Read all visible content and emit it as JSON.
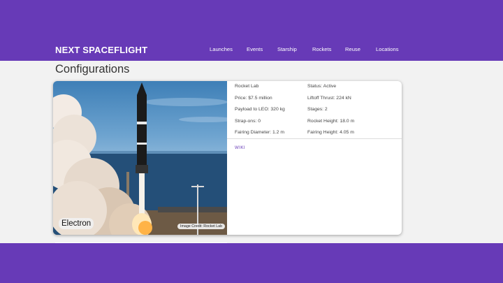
{
  "header": {
    "brand": "NEXT SPACEFLIGHT",
    "nav": [
      "Launches",
      "Events",
      "Starship",
      "Rockets",
      "Reuse",
      "Locations"
    ]
  },
  "page": {
    "title": "Configurations"
  },
  "card": {
    "rocket_name": "Electron",
    "image_credit": "Image Credit: Rocket Lab",
    "details": {
      "manufacturer": "Rocket Lab",
      "status": "Status: Active",
      "price": "Price: $7.5 million",
      "liftoff_thrust": "Liftoff Thrust: 224 kN",
      "payload_leo": "Payload to LEO: 320 kg",
      "stages": "Stages: 2",
      "strap_ons": "Strap-ons: 0",
      "rocket_height": "Rocket Height: 18.0 m",
      "fairing_diameter": "Fairing Diameter: 1.2 m",
      "fairing_height": "Fairing Height: 4.05 m"
    },
    "wiki_label": "WIKI"
  },
  "colors": {
    "brand": "#673ab7",
    "page_bg": "#f2f2f2"
  }
}
